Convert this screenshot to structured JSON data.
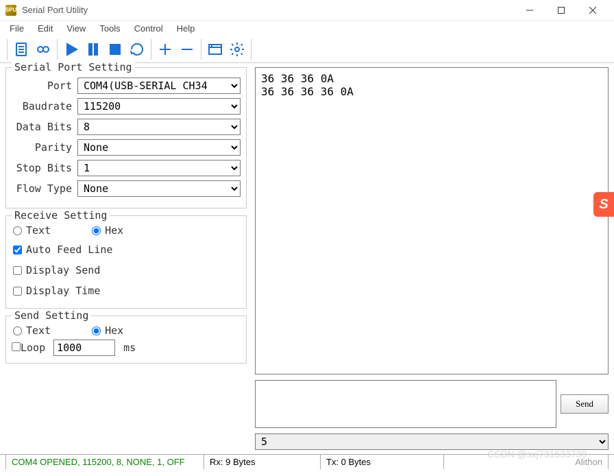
{
  "window": {
    "title": "Serial Port Utility",
    "icon_label": "SPU"
  },
  "menu": [
    "File",
    "Edit",
    "View",
    "Tools",
    "Control",
    "Help"
  ],
  "serial_port_setting": {
    "title": "Serial Port Setting",
    "port_label": "Port",
    "port_value": "COM4(USB-SERIAL CH34",
    "baudrate_label": "Baudrate",
    "baudrate_value": "115200",
    "databits_label": "Data Bits",
    "databits_value": "8",
    "parity_label": "Parity",
    "parity_value": "None",
    "stopbits_label": "Stop Bits",
    "stopbits_value": "1",
    "flow_label": "Flow Type",
    "flow_value": "None"
  },
  "receive_setting": {
    "title": "Receive Setting",
    "text_label": "Text",
    "hex_label": "Hex",
    "mode": "hex",
    "auto_feed_line_label": "Auto Feed Line",
    "auto_feed_line": true,
    "display_send_label": "Display Send",
    "display_send": false,
    "display_time_label": "Display Time",
    "display_time": false
  },
  "send_setting": {
    "title": "Send Setting",
    "text_label": "Text",
    "hex_label": "Hex",
    "mode": "hex",
    "loop_label": "Loop",
    "loop": false,
    "loop_ms": "1000",
    "ms_label": "ms"
  },
  "right": {
    "output": "36 36 36 0A\n36 36 36 36 0A",
    "input_value": "",
    "send_btn": "Send",
    "history_value": "5"
  },
  "status": {
    "conn": "COM4 OPENED, 115200, 8, NONE, 1, OFF",
    "rx": "Rx: 9 Bytes",
    "tx": "Tx: 0 Bytes",
    "brand": "Alithon"
  },
  "watermark": "CSDN @sxj731533730",
  "sidebadge": "S"
}
